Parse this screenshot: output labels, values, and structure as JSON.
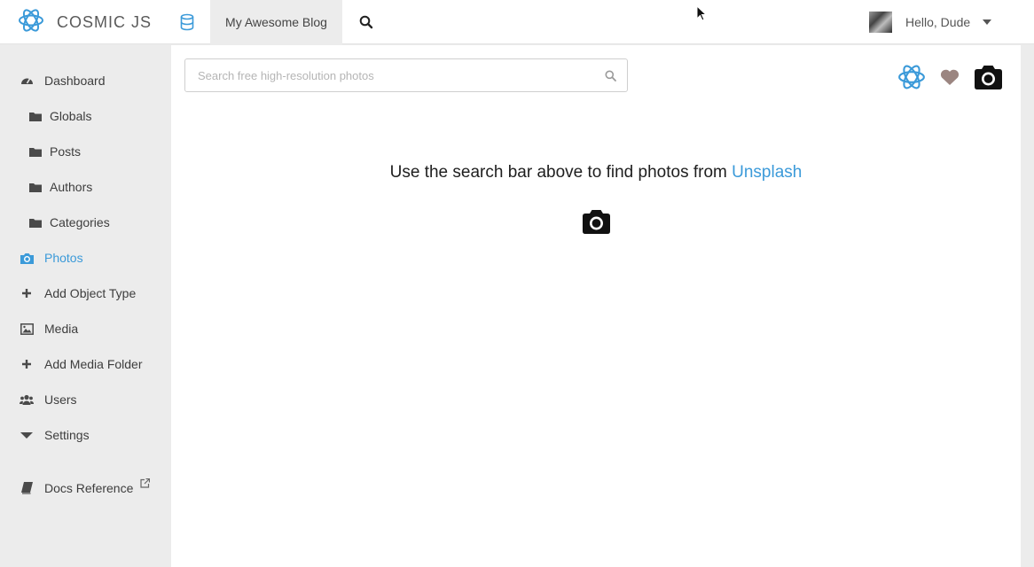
{
  "brand": {
    "name": "COSMIC JS",
    "accent": "#3b9ad9"
  },
  "topnav": {
    "bucket_name": "My Awesome Blog",
    "user_greeting": "Hello, Dude",
    "icons": [
      "database-icon",
      "search-icon",
      "caret-down-icon"
    ]
  },
  "sidebar": {
    "items": [
      {
        "label": "Dashboard",
        "icon": "dashboard-icon",
        "level": 1
      },
      {
        "label": "Globals",
        "icon": "folder-icon",
        "level": 2
      },
      {
        "label": "Posts",
        "icon": "folder-icon",
        "level": 2
      },
      {
        "label": "Authors",
        "icon": "folder-icon",
        "level": 2
      },
      {
        "label": "Categories",
        "icon": "folder-icon",
        "level": 2
      },
      {
        "label": "Photos",
        "icon": "camera-icon",
        "level": 1,
        "active": true
      },
      {
        "label": "Add Object Type",
        "icon": "plus-icon",
        "level": 1
      },
      {
        "label": "Media",
        "icon": "image-icon",
        "level": 1
      },
      {
        "label": "Add Media Folder",
        "icon": "plus-icon",
        "level": 1
      },
      {
        "label": "Users",
        "icon": "users-icon",
        "level": 1
      },
      {
        "label": "Settings",
        "icon": "caret-down-icon",
        "level": 1
      },
      {
        "label": "Docs Reference",
        "icon": "book-icon",
        "level": 1,
        "external": true
      }
    ]
  },
  "main": {
    "search": {
      "placeholder": "Search free high-resolution photos",
      "value": ""
    },
    "toolbar_icons": [
      "cosmic-logo-icon",
      "heart-icon",
      "camera-icon"
    ],
    "empty_state": {
      "text": "Use the search bar above to find photos from",
      "link_text": "Unsplash"
    }
  },
  "colors": {
    "link": "#3b9ad9",
    "heart": "#9b8580",
    "text": "#1e1e1e"
  }
}
